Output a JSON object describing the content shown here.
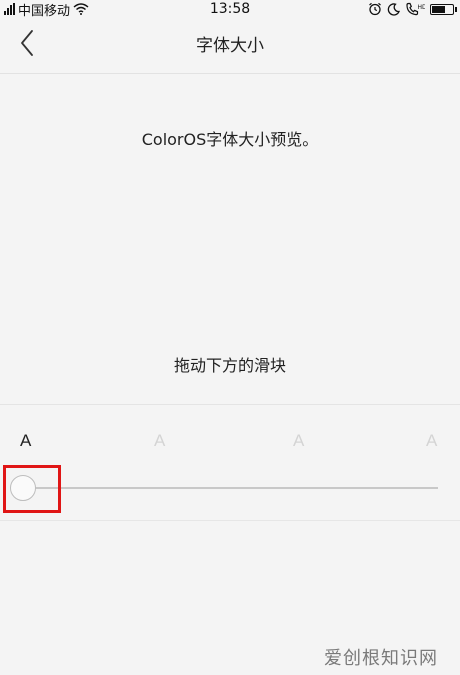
{
  "status_bar": {
    "carrier": "中国移动",
    "time": "13:58",
    "battery_level": 0.7
  },
  "nav": {
    "title": "字体大小"
  },
  "preview": {
    "sample_text": "ColorOS字体大小预览。",
    "hint": "拖动下方的滑块"
  },
  "font_size_slider": {
    "labels": [
      "A",
      "A",
      "A",
      "A"
    ],
    "selected_index": 0,
    "level_count": 4
  },
  "watermark": {
    "text": "爱创根知识网"
  },
  "colors": {
    "background": "#f4f4f4",
    "highlight": "#e01515",
    "active_label": "#222222",
    "inactive_label": "#d4d4d4",
    "track": "#c8c8c8"
  }
}
